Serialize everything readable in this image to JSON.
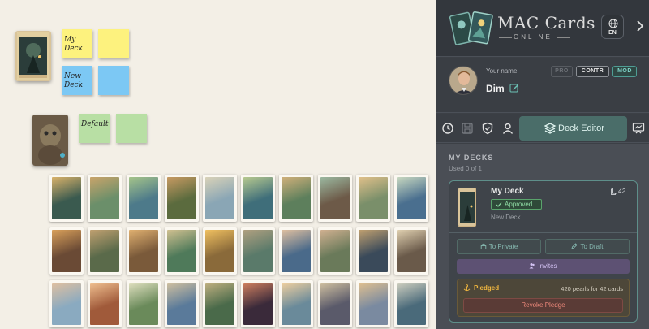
{
  "app": {
    "title": "MAC Cards",
    "subtitle": "ONLINE",
    "language": "EN"
  },
  "canvas": {
    "stickies": [
      {
        "title": "",
        "text": "My Deck",
        "color": "yellow"
      },
      {
        "title": "",
        "text": "",
        "color": "yellow"
      },
      {
        "title": "",
        "text": "New Deck",
        "color": "blue"
      },
      {
        "title": "",
        "text": "",
        "color": "blue"
      },
      {
        "title": "",
        "text": "Default",
        "color": "green"
      },
      {
        "title": "",
        "text": "",
        "color": "green"
      }
    ],
    "grid_card_count": 30
  },
  "profile": {
    "name_label": "Your name",
    "name": "Dim",
    "roles": {
      "pro": "PRO",
      "contr": "CONTR",
      "mod": "MOD"
    }
  },
  "toolbar": {
    "icons": [
      "history-icon",
      "save-icon",
      "shield-icon",
      "user-icon"
    ],
    "active_tab": "Deck Editor",
    "right_icon": "presentation-icon"
  },
  "decks": {
    "title": "MY DECKS",
    "used": "Used 0 of 1",
    "items": [
      {
        "name": "My Deck",
        "count": "42",
        "status": "Approved",
        "subtitle": "New Deck",
        "to_private": "To Private",
        "to_draft": "To Draft",
        "invites": "Invites",
        "pledged_label": "Pledged",
        "pledged_info": "420 pearls for 42 cards",
        "revoke": "Revoke Pledge"
      }
    ]
  },
  "colors": {
    "canvas_bg": "#f3efe6",
    "panel_bg": "#3c4046",
    "accent_teal": "#4a6d69",
    "approved_green": "#8fdca4",
    "pledged_gold": "#f0b63f",
    "revoke_red": "#f08a7c"
  }
}
